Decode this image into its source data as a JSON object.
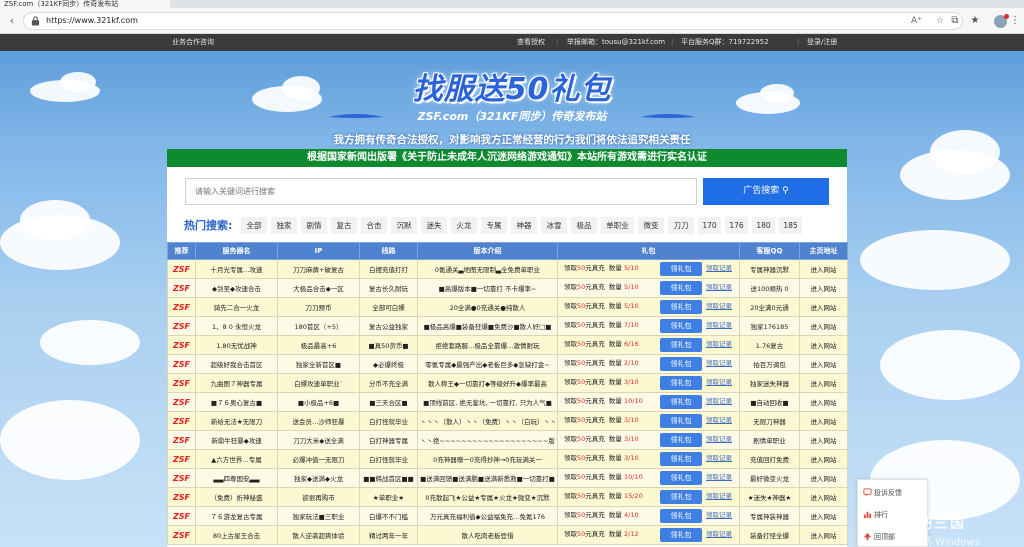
{
  "browser": {
    "tab_title": "ZSF.com（321KF同步）传奇发布站",
    "url": "https://www.321kf.com",
    "icons": [
      "back-icon",
      "lock-icon",
      "read-aloud-icon",
      "favorite-star-icon",
      "extensions-icon",
      "favorites-icon",
      "profile-icon",
      "more-menu-icon"
    ]
  },
  "topbar": {
    "left_link": "业务合作咨询",
    "links": [
      "查看授权",
      "举报邮箱：tousu@321kf.com",
      "平台服务Q群：719722952",
      "登录/注册"
    ]
  },
  "header": {
    "logo_title": "找服送50礼包",
    "logo_sub": "ZSF.com（321KF同步）传奇发布站",
    "legal_notice": "我方拥有传奇合法授权，对影响我方正常经营的行为我们将依法追究相关责任"
  },
  "banner": "根据国家新闻出版署《关于防止未成年人沉迷网络游戏通知》本站所有游戏需进行实名认证",
  "search": {
    "placeholder": "请输入关键词进行搜索",
    "button": "广告搜索"
  },
  "hot": {
    "label": "热门搜索:",
    "tags": [
      "全部",
      "独家",
      "剧情",
      "复古",
      "合击",
      "沉默",
      "迷失",
      "火龙",
      "专属",
      "神器",
      "冰雪",
      "极品",
      "单职业",
      "微变",
      "刀刀",
      "170",
      "176",
      "180",
      "185"
    ]
  },
  "table": {
    "headers": [
      "推荐",
      "服务器名",
      "IP",
      "线路",
      "版本介绍",
      "礼包",
      "客服QQ",
      "主页地址"
    ],
    "gift_prefix": "领取",
    "gift_unit": "元真充",
    "gift_count_label": "数量",
    "gift_button": "领礼包",
    "gift_log": "领取记录",
    "rows": [
      {
        "rec": "ZSF",
        "name": "十月光专属…攻速",
        "ip": "刀刀麻痹+破复古",
        "line": "白摆充值打打",
        "version": "0氪通关▃地图无限制▃全免费单职业",
        "amount": "50",
        "count": "5/10",
        "qq": "专属神器沉默",
        "home": "进入网站"
      },
      {
        "rec": "ZSF",
        "name": "◆剑至◆攻速合击",
        "ip": "大极品合击◆一区",
        "line": "复古长久耐玩",
        "version": "■高爆版本■一切靠打 不卡爆率~",
        "amount": "50",
        "count": "5/10",
        "qq": "送100顺热 0",
        "home": "进入网站"
      },
      {
        "rec": "ZSF",
        "name": "骑先二合一火龙",
        "ip": "刀刀预币",
        "line": "全部可白嫖",
        "version": "20全满●0充通关●纯散人",
        "amount": "50",
        "count": "5/10",
        "qq": "20全满0元通",
        "home": "进入网站"
      },
      {
        "rec": "ZSF",
        "name": "1、8 0 永恒火龙",
        "ip": "180首区（+5）",
        "line": "复古公益独家",
        "version": "■极品高爆■装备狂爆■免费沙■散人好□■",
        "amount": "50",
        "count": "7/10",
        "qq": "独家176185",
        "home": "进入网站"
      },
      {
        "rec": "ZSF",
        "name": "1.80无忧战神",
        "ip": "极品最高+6",
        "line": "■真50货币■",
        "version": "拒绝套路服…极品全靠爆…激情耐玩",
        "amount": "50",
        "count": "6/16",
        "qq": "1.76复古",
        "home": "进入网站"
      },
      {
        "rec": "ZSF",
        "name": "超级好我合击首区",
        "ip": "独家全新首区■",
        "line": "◆必爆终极",
        "version": "零氪专属◆最强产出◆老板巨多◆急缺打金~",
        "amount": "50",
        "count": "2/10",
        "qq": "拍百万调包",
        "home": "进入网站"
      },
      {
        "rec": "ZSF",
        "name": "九曲图７神器专属",
        "ip": "白嫖攻速单职业¨",
        "line": "分币不充全满",
        "version": "散人称王◆一切靠打◆等级好升◆爆率最高",
        "amount": "50",
        "count": "3/10",
        "qq": "独家迷失神器",
        "home": "进入网站"
      },
      {
        "rec": "ZSF",
        "name": "■７６奥心复古■",
        "ip": "■小极品+6■",
        "line": "■三天合区■",
        "version": "■顶线前区, 绝无鉴坑, 一切靠打, 只为人气■",
        "amount": "50",
        "count": "10/10",
        "qq": "■自动回收■",
        "home": "进入网站"
      },
      {
        "rec": "ZSF",
        "name": "新给无法★无限刀",
        "ip": "送会员…沙师狂暴",
        "line": "白打怪就毕业",
        "version": "丶丶丶（散人）丶丶（免费）丶丶（白玩）丶丶丶",
        "amount": "50",
        "count": "3/10",
        "qq": "无限刀神器",
        "home": "进入网站"
      },
      {
        "rec": "ZSF",
        "name": "新鼎牛狂暴◆攻速",
        "ip": "刀刀大米◆送全满",
        "line": "白打神器专属",
        "version": "丶丶绝~~~~~~~~~~~~~~~~~~~~版丶丶",
        "amount": "50",
        "count": "3/10",
        "qq": "剧情单职业",
        "home": "进入网站"
      },
      {
        "rec": "ZSF",
        "name": "▲六方世界…专属",
        "ip": "必爆冲值一无限刀",
        "line": "白打怪就毕业",
        "version": "0充神器赠一0充得抄神→0充玩满关一",
        "amount": "50",
        "count": "3/10",
        "qq": "充值回打免费",
        "home": "进入网站"
      },
      {
        "rec": "ZSF",
        "name": "▃▃四尊国安▃▃",
        "ip": "独家◆送满◆火龙",
        "line": "■■韩战首区■■",
        "version": "■送满回馈■送满鹏■送满新悉救■一切靠打■",
        "amount": "50",
        "count": "10/10",
        "qq": "最好微变火龙",
        "home": "进入网站"
      },
      {
        "rec": "ZSF",
        "name": "（免费）折神秘盛",
        "ip": "欲很再购市",
        "line": "★单职业★",
        "version": "0充散起飞★公益★专属★火龙★微变★沉默",
        "amount": "50",
        "count": "15/20",
        "qq": "★迷失★神器★",
        "home": "进入网站"
      },
      {
        "rec": "ZSF",
        "name": "７６游龙复古专属",
        "ip": "独家玩法■三职业",
        "line": "白爆不不门槛",
        "version": "万元真充福利值◆公益福免充…免氪176",
        "amount": "50",
        "count": "4/10",
        "qq": "专属神装神器",
        "home": "进入网站"
      },
      {
        "rec": "ZSF",
        "name": "80上古星王合击",
        "ip": "散人逆袭超爽体验",
        "line": "精过两年一年",
        "version": "散人吃肉老板登惜",
        "amount": "50",
        "count": "2/12",
        "qq": "装备打怪全爆",
        "home": "进入网站"
      }
    ]
  },
  "float_panel": {
    "items": [
      "投诉反馈",
      "排行",
      "回顶部"
    ]
  },
  "watermark": {
    "cn": "网吧三国",
    "win": "激活 Windows"
  }
}
